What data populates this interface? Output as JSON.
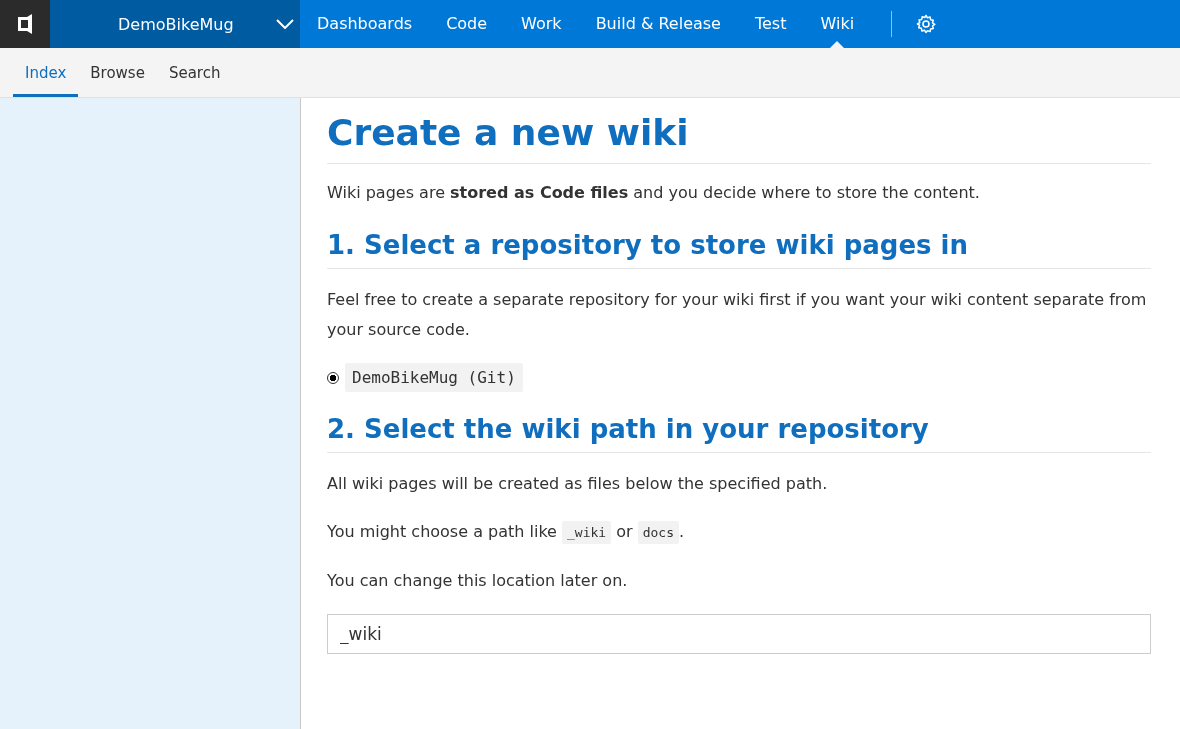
{
  "project": {
    "name": "DemoBikeMug"
  },
  "nav": [
    {
      "label": "Dashboards",
      "selected": false
    },
    {
      "label": "Code",
      "selected": false
    },
    {
      "label": "Work",
      "selected": false
    },
    {
      "label": "Build & Release",
      "selected": false
    },
    {
      "label": "Test",
      "selected": false
    },
    {
      "label": "Wiki",
      "selected": true
    }
  ],
  "subnav": [
    {
      "label": "Index",
      "selected": true
    },
    {
      "label": "Browse",
      "selected": false
    },
    {
      "label": "Search",
      "selected": false
    }
  ],
  "content": {
    "title": "Create a new wiki",
    "intro": "Wiki pages are **stored as Code files** and you decide where to store the content.",
    "section_1": {
      "heading": "1. Select a repository to store wiki pages in",
      "text": "Feel free to create a separate repository for your wiki first if you want your wiki content separate from your source code.",
      "repositories": [
        {
          "label": "DemoBikeMug (Git)",
          "selected": true
        }
      ]
    },
    "section_2": {
      "heading": "2. Select the wiki path in your repository",
      "paragraphs": [
        [
          {
            "kind": "text",
            "text": "All wiki pages will be created as files below the specified path."
          }
        ],
        [
          {
            "kind": "text",
            "text": "You might choose a path like "
          },
          {
            "kind": "code",
            "text": "_wiki"
          },
          {
            "kind": "text",
            "text": " or "
          },
          {
            "kind": "code",
            "text": "docs"
          },
          {
            "kind": "text",
            "text": "."
          }
        ],
        [
          {
            "kind": "text",
            "text": "You can change this location later on."
          }
        ]
      ],
      "path_value": "_wiki"
    }
  }
}
